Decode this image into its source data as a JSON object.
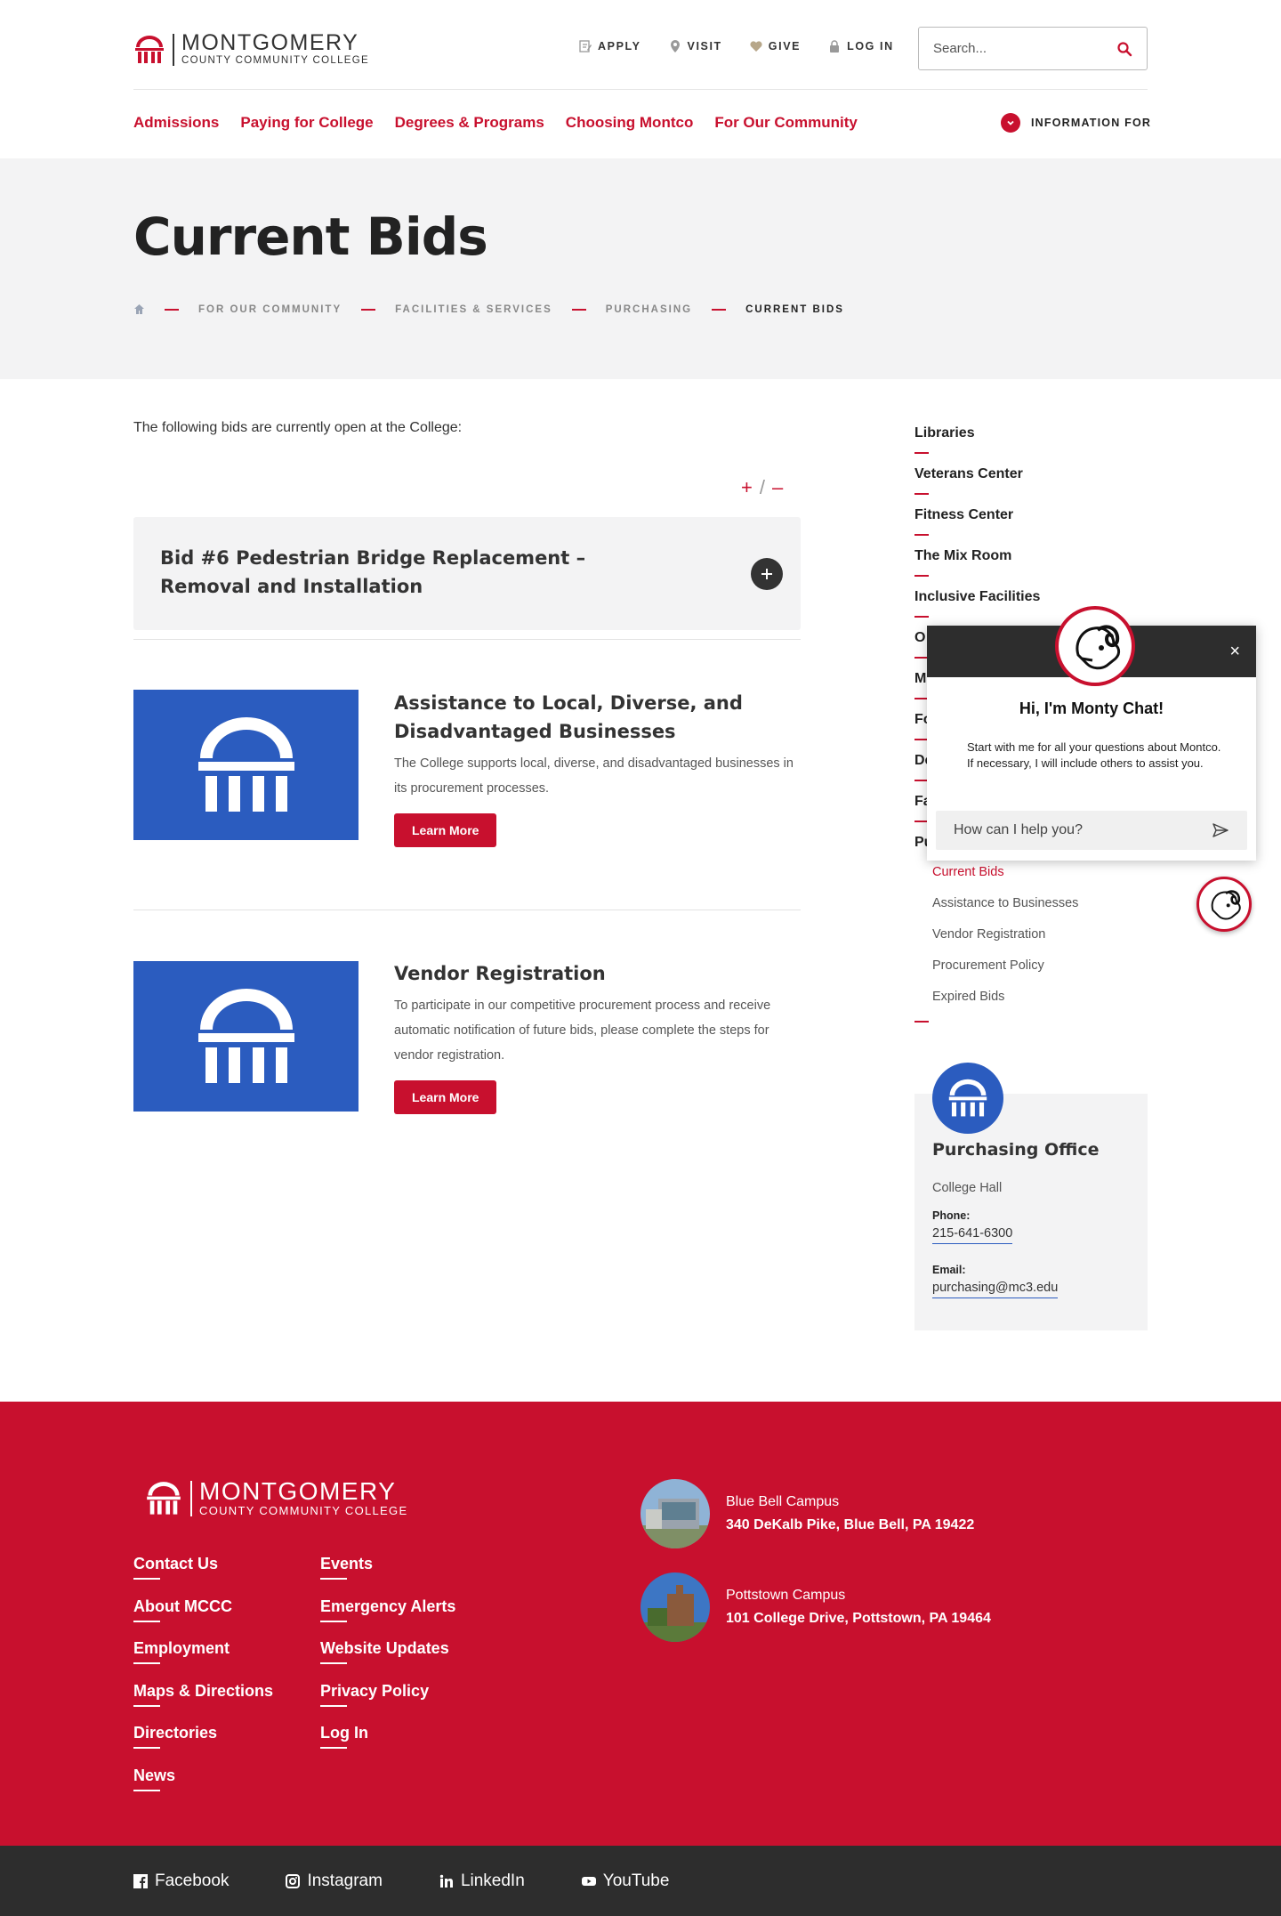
{
  "header": {
    "logo": {
      "line1": "MONTGOMERY",
      "line2": "COUNTY COMMUNITY COLLEGE"
    },
    "utility_nav": [
      {
        "label": "APPLY",
        "icon": "pencil-doc-icon"
      },
      {
        "label": "VISIT",
        "icon": "map-pin-icon"
      },
      {
        "label": "GIVE",
        "icon": "heart-icon"
      },
      {
        "label": "LOG IN",
        "icon": "lock-icon"
      }
    ],
    "search": {
      "placeholder": "Search..."
    },
    "main_nav": [
      "Admissions",
      "Paying for College",
      "Degrees & Programs",
      "Choosing Montco",
      "For Our Community"
    ],
    "info_for": "INFORMATION FOR"
  },
  "hero": {
    "title": "Current Bids",
    "breadcrumb": [
      "FOR OUR COMMUNITY",
      "FACILITIES & SERVICES",
      "PURCHASING",
      "CURRENT BIDS"
    ]
  },
  "main": {
    "intro": "The following bids are currently open at the College:",
    "expand": {
      "plus": "+",
      "slash": "/",
      "minus": "–"
    },
    "accordion": {
      "title": "Bid #6 Pedestrian Bridge Replacement – Removal and Installation"
    },
    "cards": [
      {
        "title": "Assistance to Local, Diverse, and Disadvantaged Businesses",
        "text": "The College supports local, diverse, and disadvantaged businesses in its procurement processes.",
        "button": "Learn More"
      },
      {
        "title": "Vendor Registration",
        "text": "To participate in our competitive procurement process and receive automatic notification of future bids, please complete the steps for vendor registration.",
        "button": "Learn More"
      }
    ]
  },
  "sidebar": {
    "items": [
      "Libraries",
      "Veterans Center",
      "Fitness Center",
      "The Mix Room",
      "Inclusive Facilities",
      "O",
      "M",
      "Fo",
      "De",
      "Fa",
      "Pu"
    ],
    "sub_items": [
      "Current Bids",
      "Assistance to Businesses",
      "Vendor Registration",
      "Procurement Policy",
      "Expired Bids"
    ],
    "office": {
      "title": "Purchasing Office",
      "building": "College Hall",
      "phone_label": "Phone:",
      "phone": "215-641-6300",
      "email_label": "Email:",
      "email": "purchasing@mc3.edu"
    }
  },
  "chat": {
    "title": "Hi, I'm Monty Chat!",
    "message": "Start with me for all your questions about Montco. If necessary, I will include others to assist you.",
    "placeholder": "How can I help you?",
    "close": "×"
  },
  "footer": {
    "logo": {
      "line1": "MONTGOMERY",
      "line2": "COUNTY COMMUNITY COLLEGE"
    },
    "links_col1": [
      "Contact Us",
      "About MCCC",
      "Employment",
      "Maps & Directions",
      "Directories",
      "News"
    ],
    "links_col2": [
      "Events",
      "Emergency Alerts",
      "Website Updates",
      "Privacy Policy",
      "Log In"
    ],
    "campuses": [
      {
        "name": "Blue Bell Campus",
        "address": "340 DeKalb Pike, Blue Bell, PA 19422"
      },
      {
        "name": "Pottstown Campus",
        "address": "101 College Drive, Pottstown, PA 19464"
      }
    ],
    "social": [
      "Facebook",
      "Instagram",
      "LinkedIn",
      "YouTube"
    ]
  },
  "colors": {
    "brand_red": "#c8102e",
    "brand_blue": "#2b5cbf",
    "dark": "#2d2d2d",
    "hero_bg": "#f3f3f4"
  }
}
